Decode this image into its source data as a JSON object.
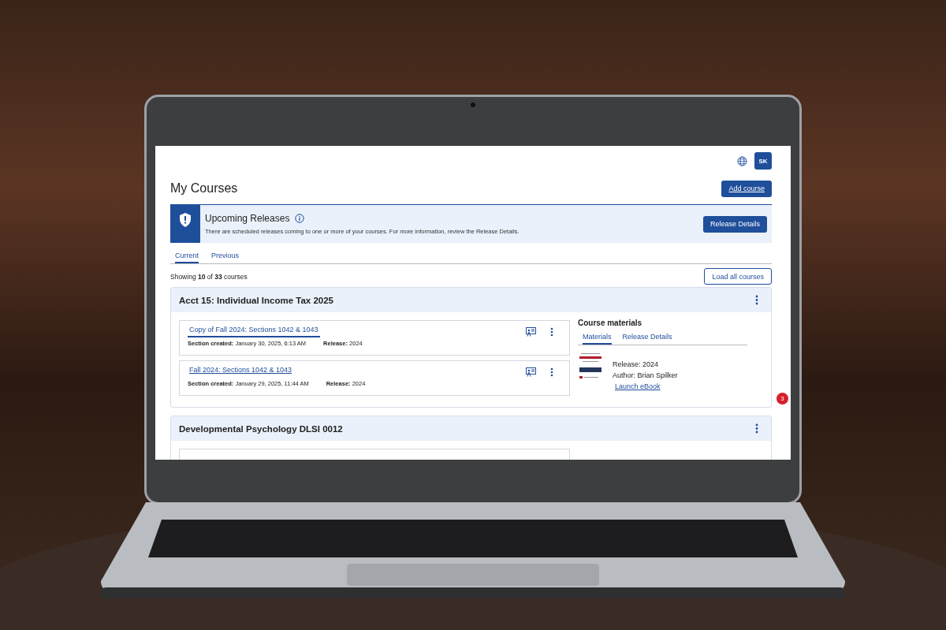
{
  "user": {
    "initials": "SK"
  },
  "page_title": "My Courses",
  "add_button": "Add course",
  "banner": {
    "title": "Upcoming Releases",
    "text": "There are scheduled releases coming to one or more of your courses. For more information, review the Release Details.",
    "button": "Release Details"
  },
  "tabs": [
    {
      "label": "Current",
      "selected": true
    },
    {
      "label": "Previous",
      "selected": false
    }
  ],
  "summary": "Showing **10** of **33** courses",
  "load_button": "Load all courses",
  "courses": [
    {
      "title": "Acct 15: Individual Income Tax 2025",
      "sections": [
        {
          "name": "Copy of Fall 2024: Sections 1042 & 1043",
          "selected": true,
          "created": "**Section created:** January 30, 2025, 6:13 AM",
          "release": "**Release:** 2024"
        },
        {
          "name": "Fall 2024: Sections 1042 & 1043",
          "selected": false,
          "created": "**Section created:** January 29, 2025, 11:44 AM",
          "release": "**Release:** 2024"
        }
      ],
      "materials": {
        "heading": "Course materials",
        "tabs": [
          {
            "label": "Materials",
            "selected": true
          },
          {
            "label": "Release Details",
            "selected": false
          }
        ],
        "release": "Release: 2024",
        "author": "Author: Brian Spilker",
        "link": "Launch eBook"
      }
    },
    {
      "title": "Developmental Psychology DLSI 0012"
    }
  ],
  "notification_count": "3"
}
